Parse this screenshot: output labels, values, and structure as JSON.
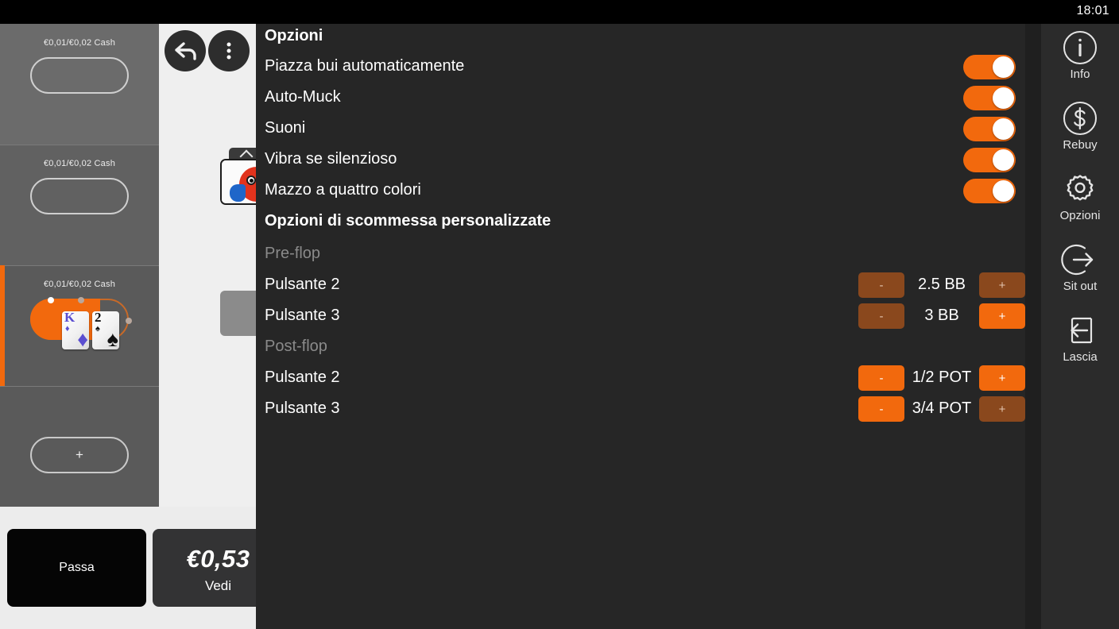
{
  "statusbar": {
    "clock": "18:01"
  },
  "table_list": {
    "items": [
      {
        "stake": "€0,01/€0,02 Cash",
        "state": "idle"
      },
      {
        "stake": "€0,01/€0,02 Cash",
        "state": "idle"
      },
      {
        "stake": "€0,01/€0,02 Cash",
        "state": "active",
        "cards": [
          {
            "rank": "K",
            "suit": "♦",
            "color": "blue"
          },
          {
            "rank": "2",
            "suit": "♠",
            "color": "black"
          }
        ]
      }
    ],
    "add_label": "+"
  },
  "game": {
    "back_icon": "back-arrow-icon",
    "menu_icon": "overflow-menu-icon",
    "avatar_icon": "player-avatar"
  },
  "actions": {
    "fold_label": "Passa",
    "call_amount": "€0,53",
    "call_label": "Vedi"
  },
  "dialog": {
    "title": "Opzioni",
    "toggles": [
      {
        "label": "Piazza bui automaticamente",
        "on": true
      },
      {
        "label": "Auto-Muck",
        "on": true
      },
      {
        "label": "Suoni",
        "on": true
      },
      {
        "label": "Vibra se silenzioso",
        "on": true
      },
      {
        "label": "Mazzo a quattro colori",
        "on": true
      }
    ],
    "custom_bets_title": "Opzioni di scommessa personalizzate",
    "groups": [
      {
        "heading": "Pre-flop",
        "rows": [
          {
            "label": "Pulsante 2",
            "value": "2.5 BB",
            "minus": "-",
            "plus": "+",
            "minus_enabled": false,
            "plus_enabled": false
          },
          {
            "label": "Pulsante 3",
            "value": "3 BB",
            "minus": "-",
            "plus": "+",
            "minus_enabled": false,
            "plus_enabled": true
          }
        ]
      },
      {
        "heading": "Post-flop",
        "rows": [
          {
            "label": "Pulsante 2",
            "value": "1/2 POT",
            "minus": "-",
            "plus": "+",
            "minus_enabled": true,
            "plus_enabled": true
          },
          {
            "label": "Pulsante 3",
            "value": "3/4 POT",
            "minus": "-",
            "plus": "+",
            "minus_enabled": true,
            "plus_enabled": false
          }
        ]
      }
    ]
  },
  "sidebar": {
    "items": [
      {
        "label": "Info",
        "icon": "info-icon"
      },
      {
        "label": "Rebuy",
        "icon": "dollar-icon"
      },
      {
        "label": "Opzioni",
        "icon": "gear-icon"
      },
      {
        "label": "Sit out",
        "icon": "sit-out-icon"
      },
      {
        "label": "Lascia",
        "icon": "leave-icon"
      }
    ]
  },
  "colors": {
    "accent": "#f2690d",
    "accent_dim": "#8a481d",
    "dialog_bg": "#262626",
    "sidebar_bg": "#2b2b2b"
  }
}
